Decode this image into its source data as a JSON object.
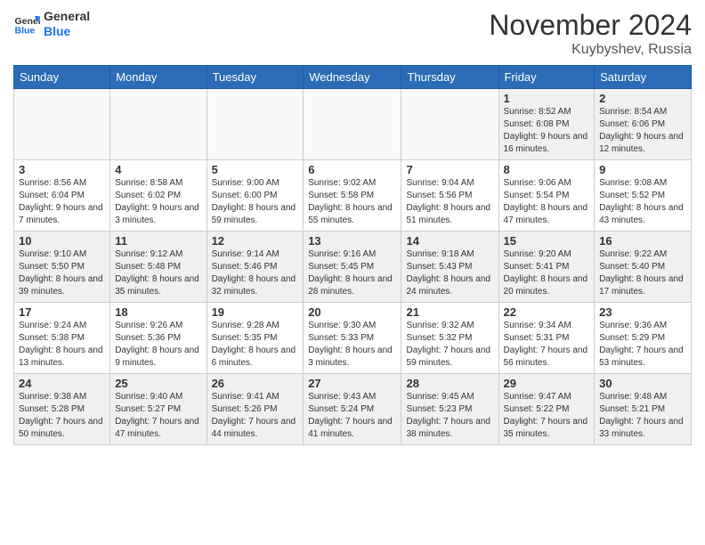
{
  "header": {
    "logo_text_general": "General",
    "logo_text_blue": "Blue",
    "month": "November 2024",
    "location": "Kuybyshev, Russia"
  },
  "days_of_week": [
    "Sunday",
    "Monday",
    "Tuesday",
    "Wednesday",
    "Thursday",
    "Friday",
    "Saturday"
  ],
  "weeks": [
    [
      {
        "day": "",
        "info": ""
      },
      {
        "day": "",
        "info": ""
      },
      {
        "day": "",
        "info": ""
      },
      {
        "day": "",
        "info": ""
      },
      {
        "day": "",
        "info": ""
      },
      {
        "day": "1",
        "info": "Sunrise: 8:52 AM\nSunset: 6:08 PM\nDaylight: 9 hours and 16 minutes."
      },
      {
        "day": "2",
        "info": "Sunrise: 8:54 AM\nSunset: 6:06 PM\nDaylight: 9 hours and 12 minutes."
      }
    ],
    [
      {
        "day": "3",
        "info": "Sunrise: 8:56 AM\nSunset: 6:04 PM\nDaylight: 9 hours and 7 minutes."
      },
      {
        "day": "4",
        "info": "Sunrise: 8:58 AM\nSunset: 6:02 PM\nDaylight: 9 hours and 3 minutes."
      },
      {
        "day": "5",
        "info": "Sunrise: 9:00 AM\nSunset: 6:00 PM\nDaylight: 8 hours and 59 minutes."
      },
      {
        "day": "6",
        "info": "Sunrise: 9:02 AM\nSunset: 5:58 PM\nDaylight: 8 hours and 55 minutes."
      },
      {
        "day": "7",
        "info": "Sunrise: 9:04 AM\nSunset: 5:56 PM\nDaylight: 8 hours and 51 minutes."
      },
      {
        "day": "8",
        "info": "Sunrise: 9:06 AM\nSunset: 5:54 PM\nDaylight: 8 hours and 47 minutes."
      },
      {
        "day": "9",
        "info": "Sunrise: 9:08 AM\nSunset: 5:52 PM\nDaylight: 8 hours and 43 minutes."
      }
    ],
    [
      {
        "day": "10",
        "info": "Sunrise: 9:10 AM\nSunset: 5:50 PM\nDaylight: 8 hours and 39 minutes."
      },
      {
        "day": "11",
        "info": "Sunrise: 9:12 AM\nSunset: 5:48 PM\nDaylight: 8 hours and 35 minutes."
      },
      {
        "day": "12",
        "info": "Sunrise: 9:14 AM\nSunset: 5:46 PM\nDaylight: 8 hours and 32 minutes."
      },
      {
        "day": "13",
        "info": "Sunrise: 9:16 AM\nSunset: 5:45 PM\nDaylight: 8 hours and 28 minutes."
      },
      {
        "day": "14",
        "info": "Sunrise: 9:18 AM\nSunset: 5:43 PM\nDaylight: 8 hours and 24 minutes."
      },
      {
        "day": "15",
        "info": "Sunrise: 9:20 AM\nSunset: 5:41 PM\nDaylight: 8 hours and 20 minutes."
      },
      {
        "day": "16",
        "info": "Sunrise: 9:22 AM\nSunset: 5:40 PM\nDaylight: 8 hours and 17 minutes."
      }
    ],
    [
      {
        "day": "17",
        "info": "Sunrise: 9:24 AM\nSunset: 5:38 PM\nDaylight: 8 hours and 13 minutes."
      },
      {
        "day": "18",
        "info": "Sunrise: 9:26 AM\nSunset: 5:36 PM\nDaylight: 8 hours and 9 minutes."
      },
      {
        "day": "19",
        "info": "Sunrise: 9:28 AM\nSunset: 5:35 PM\nDaylight: 8 hours and 6 minutes."
      },
      {
        "day": "20",
        "info": "Sunrise: 9:30 AM\nSunset: 5:33 PM\nDaylight: 8 hours and 3 minutes."
      },
      {
        "day": "21",
        "info": "Sunrise: 9:32 AM\nSunset: 5:32 PM\nDaylight: 7 hours and 59 minutes."
      },
      {
        "day": "22",
        "info": "Sunrise: 9:34 AM\nSunset: 5:31 PM\nDaylight: 7 hours and 56 minutes."
      },
      {
        "day": "23",
        "info": "Sunrise: 9:36 AM\nSunset: 5:29 PM\nDaylight: 7 hours and 53 minutes."
      }
    ],
    [
      {
        "day": "24",
        "info": "Sunrise: 9:38 AM\nSunset: 5:28 PM\nDaylight: 7 hours and 50 minutes."
      },
      {
        "day": "25",
        "info": "Sunrise: 9:40 AM\nSunset: 5:27 PM\nDaylight: 7 hours and 47 minutes."
      },
      {
        "day": "26",
        "info": "Sunrise: 9:41 AM\nSunset: 5:26 PM\nDaylight: 7 hours and 44 minutes."
      },
      {
        "day": "27",
        "info": "Sunrise: 9:43 AM\nSunset: 5:24 PM\nDaylight: 7 hours and 41 minutes."
      },
      {
        "day": "28",
        "info": "Sunrise: 9:45 AM\nSunset: 5:23 PM\nDaylight: 7 hours and 38 minutes."
      },
      {
        "day": "29",
        "info": "Sunrise: 9:47 AM\nSunset: 5:22 PM\nDaylight: 7 hours and 35 minutes."
      },
      {
        "day": "30",
        "info": "Sunrise: 9:48 AM\nSunset: 5:21 PM\nDaylight: 7 hours and 33 minutes."
      }
    ]
  ]
}
